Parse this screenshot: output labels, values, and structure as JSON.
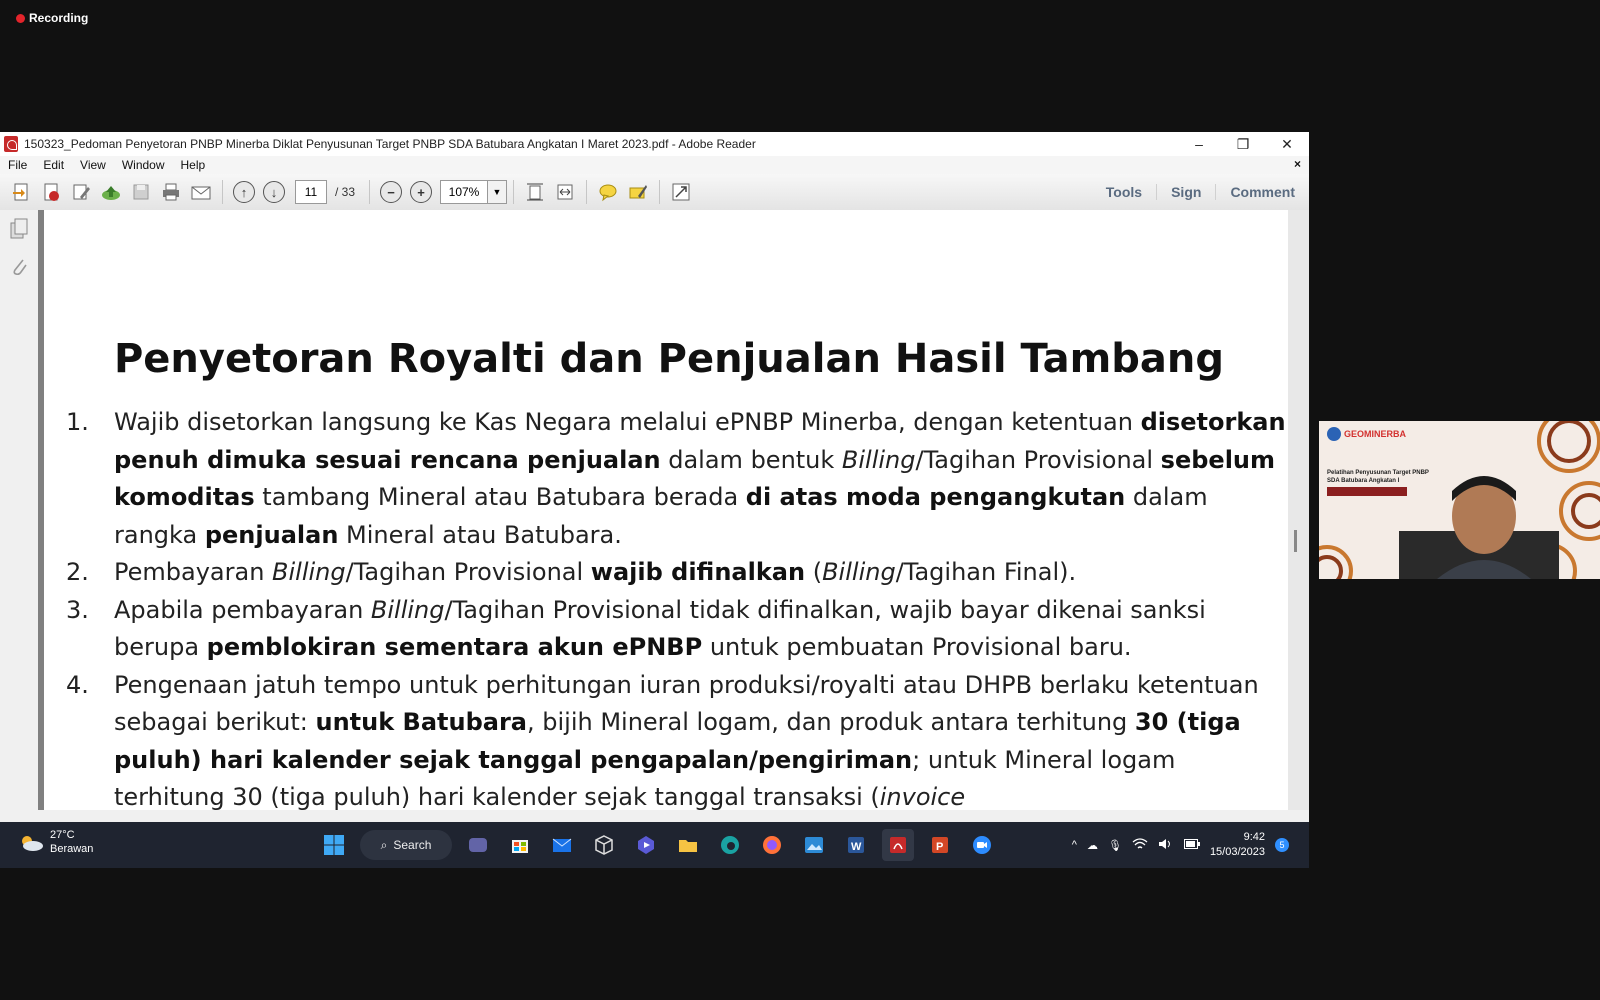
{
  "recording": {
    "label": "Recording"
  },
  "window": {
    "title": "150323_Pedoman Penyetoran PNBP Minerba Diklat Penyusunan Target PNBP SDA Batubara Angkatan I Maret 2023.pdf - Adobe Reader",
    "minimize": "–",
    "restore": "❐",
    "close": "✕"
  },
  "menu": {
    "items": [
      "File",
      "Edit",
      "View",
      "Window",
      "Help"
    ],
    "close": "×"
  },
  "toolbar": {
    "page_current": "11",
    "page_total": "/ 33",
    "zoom": "107%",
    "tools": "Tools",
    "sign": "Sign",
    "comment": "Comment"
  },
  "document": {
    "title": "Penyetoran Royalti dan Penjualan Hasil Tambang",
    "items": [
      {
        "num": "1.",
        "segments": [
          {
            "t": "Wajib disetorkan langsung ke Kas Negara melalui ePNBP Minerba, dengan ketentuan "
          },
          {
            "t": "disetorkan penuh dimuka sesuai rencana penjualan",
            "b": true
          },
          {
            "t": " dalam bentuk "
          },
          {
            "t": "Billing",
            "i": true
          },
          {
            "t": "/Tagihan Provisional "
          },
          {
            "t": "sebelum komoditas",
            "b": true
          },
          {
            "t": " tambang Mineral atau Batubara berada "
          },
          {
            "t": "di atas moda pengangkutan",
            "b": true
          },
          {
            "t": " dalam rangka "
          },
          {
            "t": "penjualan",
            "b": true
          },
          {
            "t": " Mineral atau Batubara."
          }
        ]
      },
      {
        "num": "2.",
        "segments": [
          {
            "t": "Pembayaran "
          },
          {
            "t": "Billing",
            "i": true
          },
          {
            "t": "/Tagihan Provisional "
          },
          {
            "t": "wajib difinalkan",
            "b": true
          },
          {
            "t": " ("
          },
          {
            "t": "Billing",
            "i": true
          },
          {
            "t": "/Tagihan Final)."
          }
        ]
      },
      {
        "num": "3.",
        "segments": [
          {
            "t": "Apabila pembayaran "
          },
          {
            "t": "Billing",
            "i": true
          },
          {
            "t": "/Tagihan Provisional tidak difinalkan, wajib bayar dikenai sanksi berupa "
          },
          {
            "t": "pemblokiran sementara akun ePNBP",
            "b": true
          },
          {
            "t": " untuk pembuatan Provisional baru."
          }
        ]
      },
      {
        "num": "4.",
        "segments": [
          {
            "t": "Pengenaan jatuh tempo untuk perhitungan iuran produksi/royalti atau DHPB berlaku ketentuan sebagai berikut: "
          },
          {
            "t": "untuk Batubara",
            "b": true
          },
          {
            "t": ", bijih Mineral logam, dan produk antara terhitung "
          },
          {
            "t": "30 (tiga puluh) hari kalender sejak tanggal pengapalan/pengiriman",
            "b": true
          },
          {
            "t": "; untuk Mineral logam terhitung 30 (tiga puluh) hari kalender sejak tanggal transaksi ("
          },
          {
            "t": "invoice",
            "i": true
          }
        ]
      }
    ]
  },
  "taskbar": {
    "weather_temp": "27°C",
    "weather_desc": "Berawan",
    "search": "Search",
    "time": "9:42",
    "date": "15/03/2023",
    "notif": "5"
  },
  "webcam": {
    "logo": "GEOMINERBA",
    "subtitle": "Pelatihan Penyusunan Target PNBP SDA Batubara Angkatan I"
  },
  "colors": {
    "accent_red": "#c62a2a",
    "taskbar": "#1f2430",
    "tool_link": "#5a6b80"
  }
}
